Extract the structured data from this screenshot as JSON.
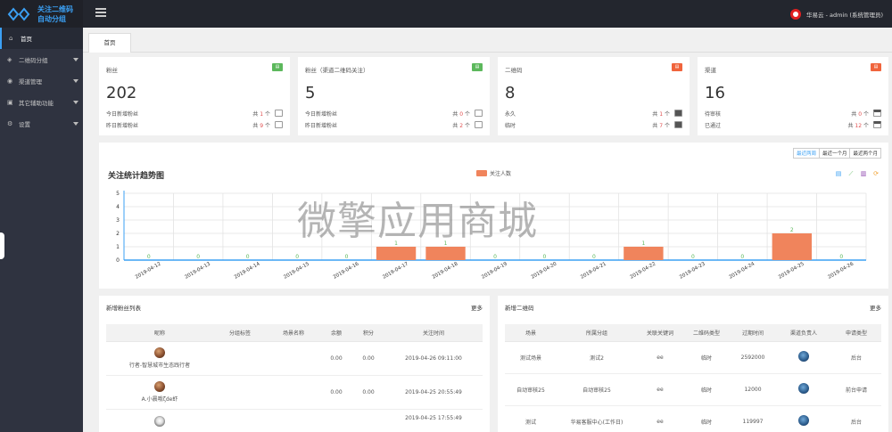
{
  "app": {
    "logo_line1": "关注二维码",
    "logo_line2": "自动分组"
  },
  "header": {
    "user_text": "华易云 - admin (系统管理员)"
  },
  "sidebar": {
    "items": [
      {
        "label": "首页",
        "icon": "home-icon"
      },
      {
        "label": "二维码分组",
        "icon": "layers-icon"
      },
      {
        "label": "渠道管理",
        "icon": "channel-icon"
      },
      {
        "label": "其它辅助功能",
        "icon": "tool-icon"
      },
      {
        "label": "设置",
        "icon": "gear-icon"
      }
    ]
  },
  "tabs": [
    {
      "label": "首页"
    }
  ],
  "stats": [
    {
      "title": "粉丝",
      "badge_color": "#5cb85c",
      "value": "202",
      "rows": [
        {
          "label": "今日新增粉丝",
          "prefix": "共",
          "num": "1",
          "suffix": "个"
        },
        {
          "label": "昨日新增粉丝",
          "prefix": "共",
          "num": "9",
          "suffix": "个"
        }
      ]
    },
    {
      "title": "粉丝（渠道二维码关注）",
      "badge_color": "#5cb85c",
      "value": "5",
      "rows": [
        {
          "label": "今日新增粉丝",
          "prefix": "共",
          "num": "0",
          "suffix": "个"
        },
        {
          "label": "昨日新增粉丝",
          "prefix": "共",
          "num": "2",
          "suffix": "个"
        }
      ]
    },
    {
      "title": "二维码",
      "badge_color": "#f0643c",
      "value": "8",
      "rows": [
        {
          "label": "永久",
          "prefix": "共",
          "num": "1",
          "suffix": "个"
        },
        {
          "label": "临时",
          "prefix": "共",
          "num": "7",
          "suffix": "个"
        }
      ]
    },
    {
      "title": "渠道",
      "badge_color": "#f0643c",
      "value": "16",
      "rows": [
        {
          "label": "待审核",
          "prefix": "共",
          "num": "0",
          "suffix": "个"
        },
        {
          "label": "已通过",
          "prefix": "共",
          "num": "12",
          "suffix": "个"
        }
      ]
    }
  ],
  "range_buttons": [
    {
      "label": "最近两周",
      "active": true
    },
    {
      "label": "最近一个月",
      "active": false
    },
    {
      "label": "最近两个月",
      "active": false
    }
  ],
  "chart_data": {
    "type": "bar",
    "title": "关注统计趋势图",
    "categories": [
      "2019-04-12",
      "2019-04-13",
      "2019-04-14",
      "2019-04-15",
      "2019-04-16",
      "2019-04-17",
      "2019-04-18",
      "2019-04-19",
      "2019-04-20",
      "2019-04-21",
      "2019-04-22",
      "2019-04-23",
      "2019-04-24",
      "2019-04-25",
      "2019-04-26"
    ],
    "series": [
      {
        "name": "关注人数",
        "values": [
          0,
          0,
          0,
          0,
          0,
          1,
          1,
          0,
          0,
          0,
          1,
          0,
          0,
          2,
          0
        ],
        "color": "#f0845c"
      }
    ],
    "yticks": [
      0,
      1,
      2,
      3,
      4,
      5
    ],
    "ylim": [
      0,
      5
    ],
    "grid": true,
    "legend": "top-center"
  },
  "fans_panel": {
    "title": "新增粉丝列表",
    "more": "更多",
    "headers": [
      "昵称",
      "分组标签",
      "场景名称",
      "余额",
      "积分",
      "关注时间"
    ],
    "rows": [
      {
        "nick": "行者-智慧城市生态践行者",
        "tag": "",
        "scene": "",
        "balance": "0.00",
        "points": "0.00",
        "time": "2019-04-26 09:11:00"
      },
      {
        "nick": "A.小晨哦ζde虾",
        "tag": "",
        "scene": "",
        "balance": "0.00",
        "points": "0.00",
        "time": "2019-04-25 20:55:49"
      },
      {
        "nick": "",
        "tag": "",
        "scene": "",
        "balance": "",
        "points": "",
        "time": "2019-04-25 17:55:49"
      }
    ]
  },
  "qr_panel": {
    "title": "新增二维码",
    "more": "更多",
    "headers": [
      "场景",
      "所属分组",
      "关联关键词",
      "二维码类型",
      "过期时间",
      "渠道负责人",
      "申请类型"
    ],
    "rows": [
      {
        "scene": "测试场景",
        "group": "测试2",
        "keyword": "ee",
        "type": "临时",
        "expire": "2592000",
        "apply": "后台"
      },
      {
        "scene": "自动审核25",
        "group": "自动审核25",
        "keyword": "ee",
        "type": "临时",
        "expire": "12000",
        "apply": "前台申请"
      },
      {
        "scene": "测试",
        "group": "华易客服中心(工作日)",
        "keyword": "ee",
        "type": "临时",
        "expire": "119997",
        "apply": "后台"
      }
    ]
  },
  "watermark": "微擎应用商城"
}
